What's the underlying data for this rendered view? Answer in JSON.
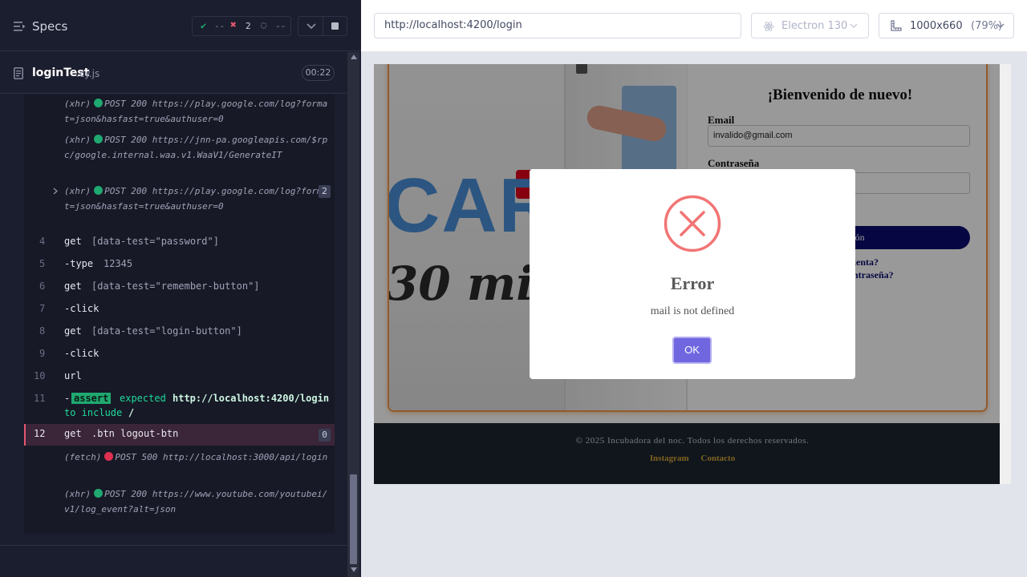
{
  "runner": {
    "specs_label": "Specs",
    "stats": {
      "passed": "--",
      "failed": "2",
      "pending": "--"
    },
    "file": {
      "name": "loginTest",
      "ext": ".cy.js",
      "duration": "00:22"
    },
    "xhr_blocks": [
      {
        "type": "(xhr)",
        "text": "POST 200 https://play.google.com/log?format=json&hasfast=true&authuser=0"
      },
      {
        "type": "(xhr)",
        "text": "POST 200 https://jnn-pa.googleapis.com/$rpc/google.internal.waa.v1.WaaV1/GenerateIT"
      },
      {
        "type": "(xhr)",
        "text": "POST 200 https://play.google.com/log?format=json&hasfast=true&authuser=0",
        "count": "2"
      }
    ],
    "commands": [
      {
        "num": "4",
        "name": "get",
        "msg": "[data-test=\"password\"]"
      },
      {
        "num": "5",
        "name": "-type",
        "msg": "12345"
      },
      {
        "num": "6",
        "name": "get",
        "msg": "[data-test=\"remember-button\"]"
      },
      {
        "num": "7",
        "name": "-click",
        "msg": ""
      },
      {
        "num": "8",
        "name": "get",
        "msg": "[data-test=\"login-button\"]"
      },
      {
        "num": "9",
        "name": "-click",
        "msg": ""
      },
      {
        "num": "10",
        "name": "url",
        "msg": ""
      },
      {
        "num": "11",
        "name": "-",
        "badge": "assert",
        "msg_pre": "expected",
        "msg_url": "http://localhost:4200/login",
        "msg_post": "to include",
        "msg_val": "/"
      },
      {
        "num": "12",
        "name": "get",
        "msg": ".btn logout-btn",
        "count": "0"
      }
    ],
    "after": [
      {
        "type": "(fetch)",
        "text": "POST 500 http://localhost:3000/api/login",
        "status": "red"
      },
      {
        "type": "(xhr)",
        "text": "POST 200 https://www.youtube.com/youtubei/v1/log_event?alt=json"
      }
    ]
  },
  "topbar": {
    "url": "http://localhost:4200/login",
    "browser": "Electron 130",
    "viewport": "1000x660",
    "scale": "(79%)"
  },
  "aut": {
    "hero_text_1": "CAR",
    "hero_text_2": "30 mi",
    "welcome": "¡Bienvenido de nuevo!",
    "email_label": "Email",
    "email_value": "invalido@gmail.com",
    "password_label": "Contraseña",
    "login_button": "Iniciar sesión",
    "link_1": "¿No tienes cuenta?",
    "link_2": "¿Olvidaste tu contraseña?",
    "footer_copy": "© 2025 Incubadora del noc. Todos los derechos reservados.",
    "footer_links": [
      "Instagram",
      "Contacto"
    ]
  },
  "dialog": {
    "title": "Error",
    "message": "mail is not defined",
    "ok": "OK"
  },
  "colors": {
    "pass": "#1fa971",
    "fail": "#e45770",
    "ok_button": "#7066e0",
    "error_icon": "#f27474"
  }
}
